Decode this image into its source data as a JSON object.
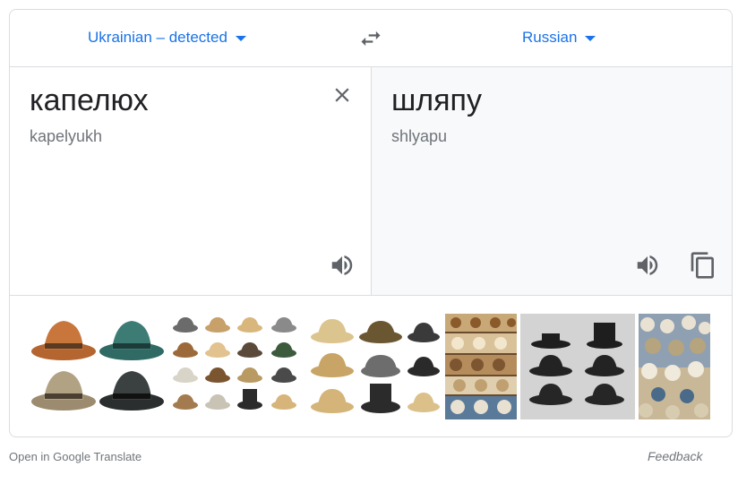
{
  "languages": {
    "source_label": "Ukrainian – detected",
    "target_label": "Russian",
    "swap_icon": "swap-arrows-icon",
    "dropdown_icon": "caret-down-icon"
  },
  "source": {
    "text": "капелюх",
    "transliteration": "kapelyukh",
    "clear_icon": "close-icon",
    "speak_icon": "speaker-icon"
  },
  "target": {
    "text": "шляпу",
    "transliteration": "shlyapu",
    "speak_icon": "speaker-icon",
    "copy_icon": "copy-icon"
  },
  "images": {
    "count": 6,
    "subject": "hats"
  },
  "footer": {
    "open_link": "Open in Google Translate",
    "feedback": "Feedback"
  },
  "colors": {
    "link_blue": "#1a73e8",
    "border": "#dadce0",
    "muted_text": "#70757a",
    "target_panel_bg": "#f8f9fa",
    "icon_gray": "#5f6368"
  }
}
